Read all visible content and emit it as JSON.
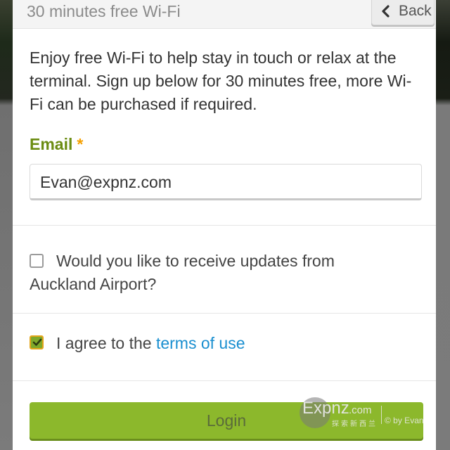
{
  "header": {
    "title": "30 minutes free Wi-Fi",
    "back_label": "Back",
    "back_icon": "chevron-left-icon"
  },
  "intro_text": "Enjoy free Wi-Fi to help stay in touch or relax at the terminal. Sign up below for 30 minutes free, more Wi-Fi can be purchased if required.",
  "email": {
    "label": "Email",
    "required_mark": "*",
    "value": "Evan@expnz.com"
  },
  "updates": {
    "checked": false,
    "label": "Would you like to receive updates from Auckland Airport?"
  },
  "terms": {
    "checked": true,
    "prefix": "I agree to the",
    "link_text": "terms of use"
  },
  "login": {
    "label": "Login"
  },
  "watermark": {
    "brand": "Expnz",
    "tld": ".com",
    "chinese": "探索新西兰",
    "credit": "© by Evan"
  },
  "colors": {
    "accent_green": "#8cb82c",
    "label_green": "#6b8c12",
    "required_orange": "#f5a000",
    "link_blue": "#1a8fd0"
  }
}
